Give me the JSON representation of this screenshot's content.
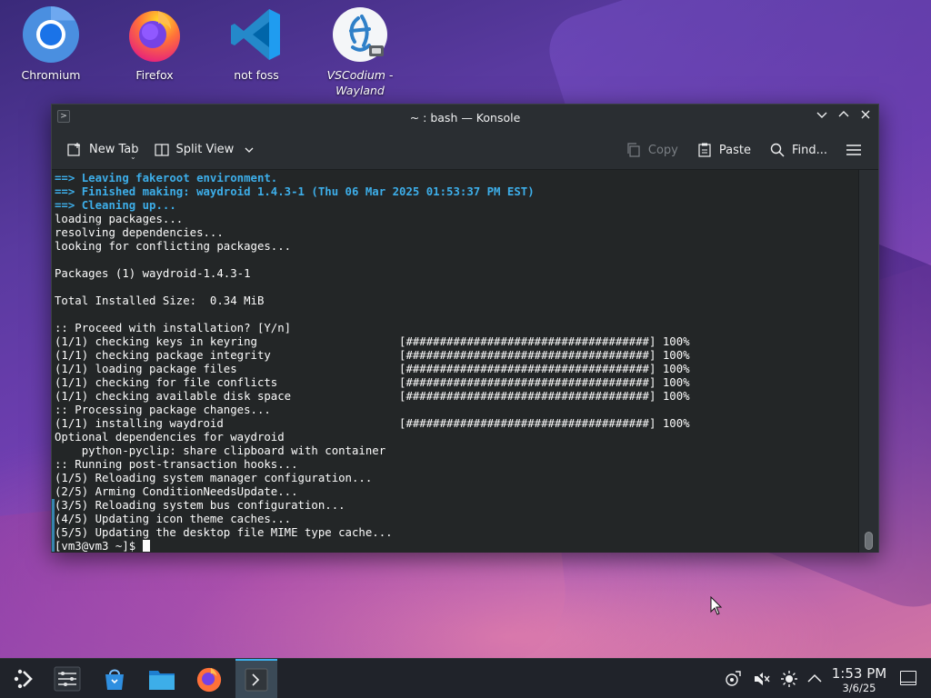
{
  "desktop": {
    "icons": [
      {
        "label": "Chromium",
        "icon": "chromium-icon"
      },
      {
        "label": "Firefox",
        "icon": "firefox-icon"
      },
      {
        "label": "not foss",
        "icon": "vscode-icon"
      },
      {
        "label": "VSCodium - Wayland",
        "icon": "vscodium-icon"
      }
    ]
  },
  "window": {
    "title": "~ : bash — Konsole",
    "toolbar": {
      "new_tab": "New Tab",
      "split_view": "Split View",
      "copy": "Copy",
      "paste": "Paste",
      "find": "Find..."
    }
  },
  "terminal": {
    "lines": [
      "==> Leaving fakeroot environment.",
      "==> Finished making: waydroid 1.4.3-1 (Thu 06 Mar 2025 01:53:37 PM EST)",
      "==> Cleaning up...",
      "loading packages...",
      "resolving dependencies...",
      "looking for conflicting packages...",
      "",
      "Packages (1) waydroid-1.4.3-1",
      "",
      "Total Installed Size:  0.34 MiB",
      "",
      ":: Proceed with installation? [Y/n]",
      "(1/1) checking keys in keyring                     [####################################] 100%",
      "(1/1) checking package integrity                   [####################################] 100%",
      "(1/1) loading package files                        [####################################] 100%",
      "(1/1) checking for file conflicts                  [####################################] 100%",
      "(1/1) checking available disk space                [####################################] 100%",
      ":: Processing package changes...",
      "(1/1) installing waydroid                          [####################################] 100%",
      "Optional dependencies for waydroid",
      "    python-pyclip: share clipboard with container",
      ":: Running post-transaction hooks...",
      "(1/5) Reloading system manager configuration...",
      "(2/5) Arming ConditionNeedsUpdate...",
      "(3/5) Reloading system bus configuration...",
      "(4/5) Updating icon theme caches...",
      "(5/5) Updating the desktop file MIME type cache..."
    ],
    "prompt": "[vm3@vm3 ~]$ "
  },
  "taskbar": {
    "time": "1:53 PM",
    "date": "3/6/25"
  },
  "colors": {
    "accent": "#3daee9",
    "terminal_bg": "#232627",
    "taskbar_bg": "#20232a"
  }
}
